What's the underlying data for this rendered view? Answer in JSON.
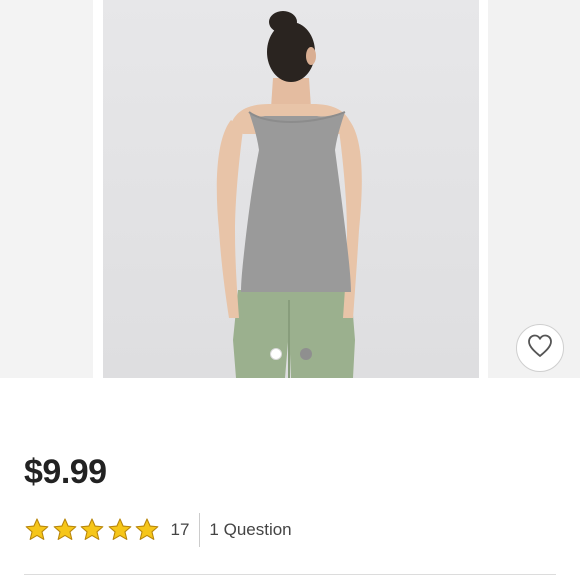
{
  "product": {
    "price": "$9.99",
    "rating": {
      "value": 5,
      "max": 5,
      "review_count": "17"
    },
    "questions_label": "1 Question"
  },
  "carousel": {
    "image_count": 2,
    "active_index": 0
  },
  "icons": {
    "favorite": "heart-outline-icon",
    "star": "star-filled-icon"
  },
  "colors": {
    "star_fill": "#F6C619",
    "star_stroke": "#B8860B",
    "price_text": "#222222",
    "tank_top": "#9a9a9a",
    "pants": "#9bb08e"
  }
}
